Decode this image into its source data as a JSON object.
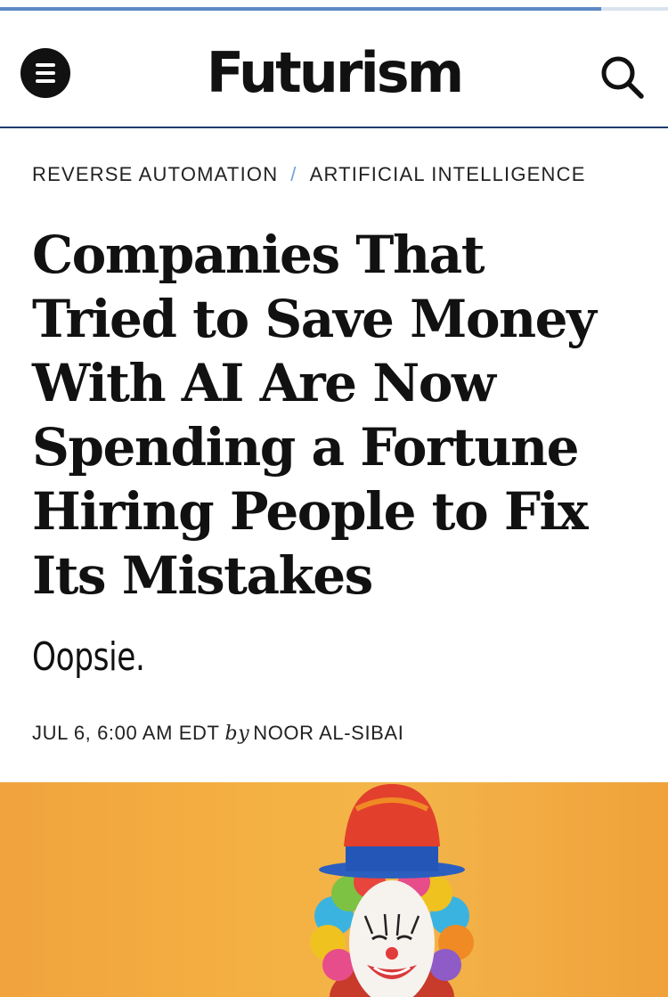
{
  "progress": {
    "fraction": 0.9
  },
  "header": {
    "logo_text": "Futurism",
    "menu_icon": "menu-icon",
    "search_icon": "search-icon",
    "accent_color": "#1f3a6e"
  },
  "article": {
    "breadcrumb": [
      "REVERSE AUTOMATION",
      "ARTIFICIAL INTELLIGENCE"
    ],
    "breadcrumb_separator": "/",
    "title_lines": [
      "Companies That",
      "Tried to Save Money",
      "With AI Are Now",
      "Spending a Fortune",
      "Hiring People to Fix",
      "Its Mistakes"
    ],
    "subtitle": "Oopsie.",
    "date": "JUL 6, 6:00 AM EDT",
    "by": "by",
    "author": "NOOR AL-SIBAI"
  },
  "hero_image": {
    "subject": "clown-photo",
    "background_color": "#f2ab40"
  }
}
